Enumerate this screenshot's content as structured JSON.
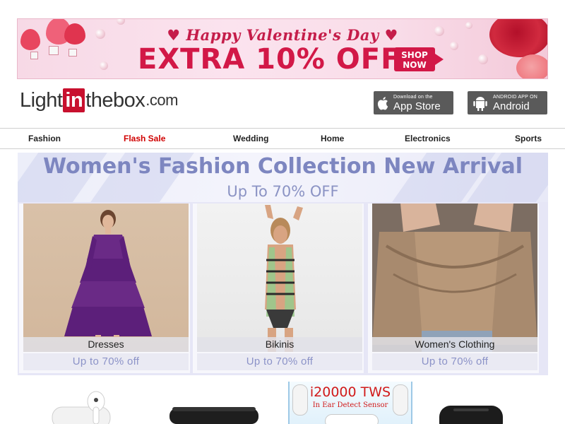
{
  "promo_banner": {
    "headline": "Happy Valentine's Day",
    "offer": "EXTRA 10% OFF",
    "cta_line1": "SHOP",
    "cta_line2": "NOW"
  },
  "header": {
    "logo_left": "Light",
    "logo_mid": "in",
    "logo_right": "thebox",
    "logo_suffix": ".com",
    "app_store": {
      "small": "Download on the",
      "big": "App Store"
    },
    "android": {
      "small": "ANDROID APP ON",
      "big": "Android"
    }
  },
  "nav": {
    "items": [
      {
        "label": "Fashion"
      },
      {
        "label": "Flash Sale"
      },
      {
        "label": "Wedding"
      },
      {
        "label": "Home"
      },
      {
        "label": "Electronics"
      },
      {
        "label": "Sports"
      }
    ]
  },
  "fashion_section": {
    "title": "Women's Fashion Collection New Arrival",
    "subtitle": "Up To 70% OFF",
    "cards": [
      {
        "name": "Dresses",
        "promo": "Up to 70% off"
      },
      {
        "name": "Bikinis",
        "promo": "Up to 70% off"
      },
      {
        "name": "Women's Clothing",
        "promo": "Up to 70% off"
      }
    ]
  },
  "electronics": {
    "tws_title": "i20000 TWS",
    "tws_subtitle": "In Ear Detect Sensor"
  },
  "colors": {
    "brand_red": "#c8102e",
    "flash_sale_red": "#d00000",
    "valentine_pink": "#d21847",
    "fashion_accent": "#7d86c0"
  }
}
